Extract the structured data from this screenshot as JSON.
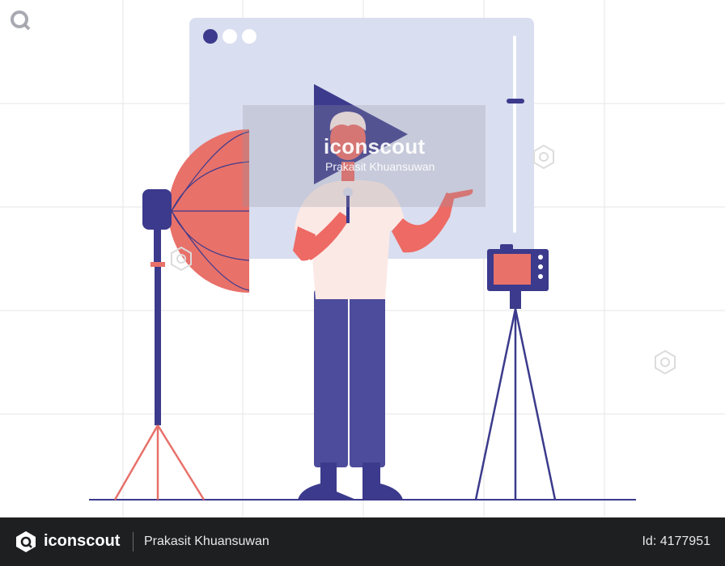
{
  "watermark": {
    "brand": "iconscout",
    "author": "Prakasit Khuansuwan"
  },
  "footer": {
    "brand": "iconscout",
    "author": "Prakasit Khuansuwan",
    "asset_id": "Id: 4177951"
  },
  "colors": {
    "navy": "#3b3a8c",
    "coral": "#e8716a",
    "window_bg": "#d9def0",
    "skin": "#ee6a64",
    "shirt": "#fbe9e6",
    "pants": "#4d4c9c",
    "grid": "#e6e6e6",
    "footer_bg": "#1e1f21"
  },
  "icons": {
    "logo": "iconscout-logo-icon",
    "play": "play-icon",
    "microphone": "microphone-icon",
    "camera": "camera-icon",
    "softbox": "softbox-light-icon"
  }
}
